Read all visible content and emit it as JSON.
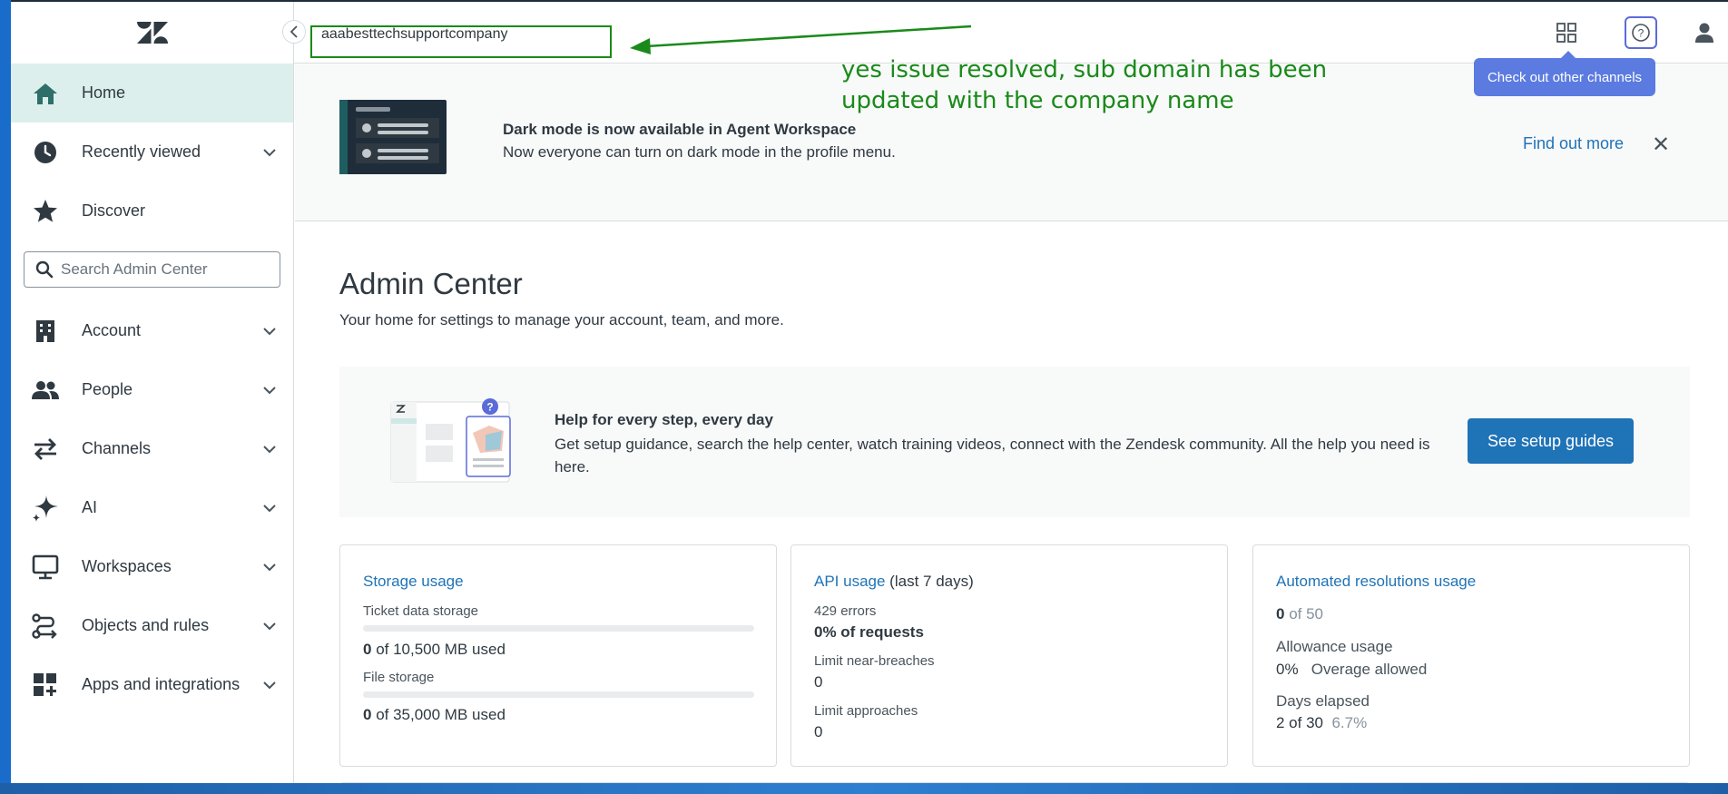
{
  "topbar": {
    "subdomain": "aaabesttechsupportcompany",
    "annotation": "yes issue resolved, sub domain has been updated with the company name",
    "tooltip": "Check out other channels",
    "icons": [
      "products-grid-icon",
      "help-icon",
      "user-icon"
    ]
  },
  "sidebar": {
    "search_placeholder": "Search Admin Center",
    "items": [
      {
        "label": "Home",
        "icon": "home-icon",
        "active": true,
        "expandable": false
      },
      {
        "label": "Recently viewed",
        "icon": "clock-icon",
        "expandable": true
      },
      {
        "label": "Discover",
        "icon": "star-icon",
        "expandable": false
      },
      {
        "label": "Account",
        "icon": "building-icon",
        "expandable": true
      },
      {
        "label": "People",
        "icon": "people-icon",
        "expandable": true
      },
      {
        "label": "Channels",
        "icon": "arrows-icon",
        "expandable": true
      },
      {
        "label": "AI",
        "icon": "sparkle-icon",
        "expandable": true
      },
      {
        "label": "Workspaces",
        "icon": "monitor-icon",
        "expandable": true
      },
      {
        "label": "Objects and rules",
        "icon": "route-icon",
        "expandable": true
      },
      {
        "label": "Apps and integrations",
        "icon": "apps-icon",
        "expandable": true
      }
    ]
  },
  "banner": {
    "title": "Dark mode is now available in Agent Workspace",
    "subtitle": "Now everyone can turn on dark mode in the profile menu.",
    "link": "Find out more"
  },
  "main": {
    "title": "Admin Center",
    "subtitle": "Your home for settings to manage your account, team, and more.",
    "help": {
      "title": "Help for every step, every day",
      "text": "Get setup guidance, search the help center, watch training videos, connect with the Zendesk community. All the help you need is here.",
      "button": "See setup guides"
    },
    "storage": {
      "title": "Storage usage",
      "ticket_label": "Ticket data storage",
      "ticket_used": "0",
      "ticket_rest": " of 10,500 MB used",
      "ticket_fraction": 0,
      "file_label": "File storage",
      "file_used": "0",
      "file_rest": " of 35,000 MB used",
      "file_fraction": 0
    },
    "api": {
      "title": "API usage",
      "title_suffix": " (last 7 days)",
      "errors_label": "429 errors",
      "errors_value": "0% of requests",
      "near_label": "Limit near-breaches",
      "near_value": "0",
      "approach_label": "Limit approaches",
      "approach_value": "0"
    },
    "automated": {
      "title": "Automated resolutions usage",
      "used": "0",
      "of": " of 50",
      "allowance_label": "Allowance usage",
      "allowance_pct": "0%",
      "overage": "Overage allowed",
      "days_label": "Days elapsed",
      "days_value": "2 of 30",
      "days_pct": "6.7%"
    }
  }
}
